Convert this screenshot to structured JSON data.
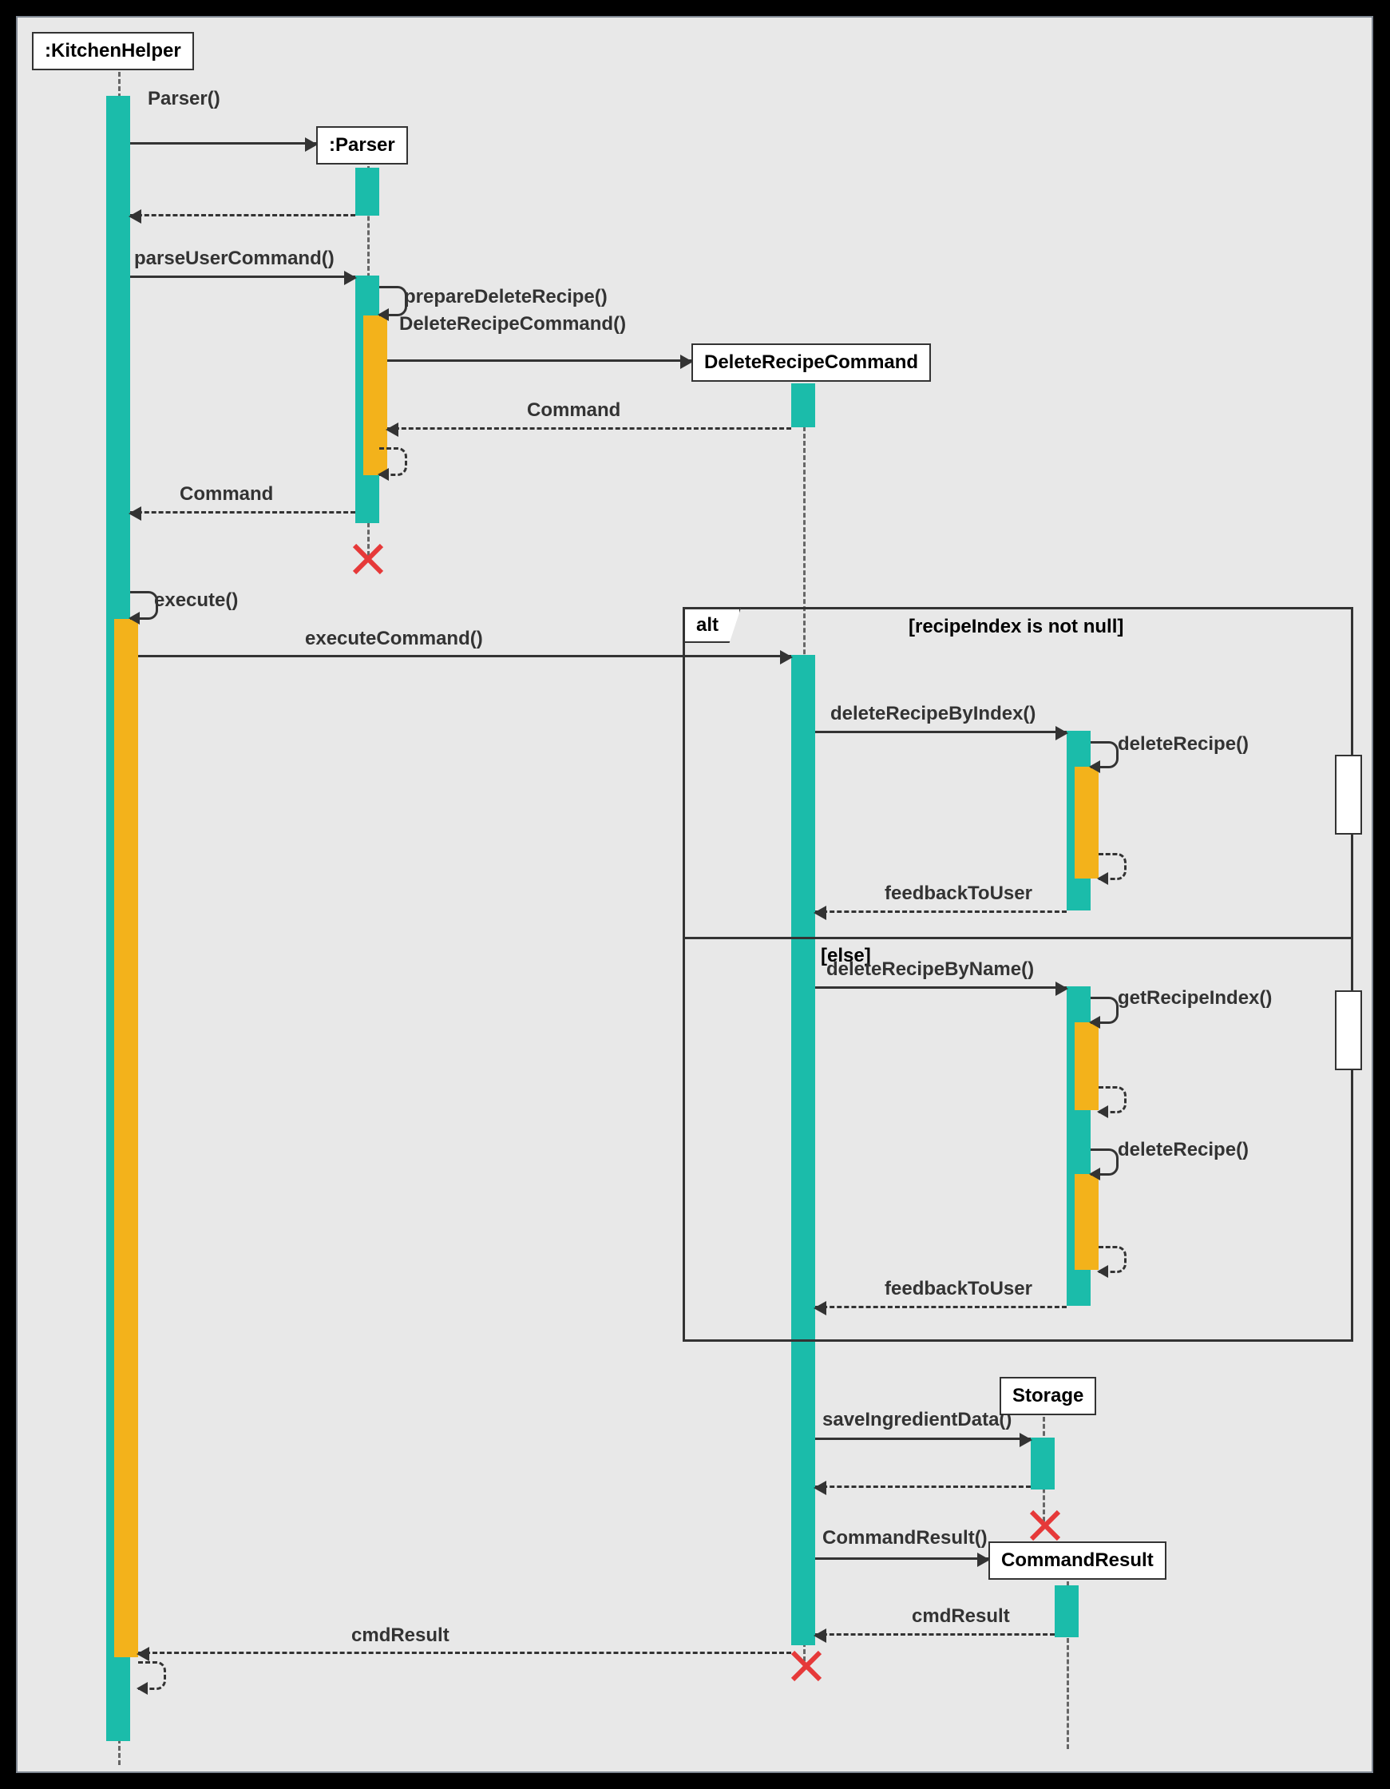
{
  "lifelines": {
    "kitchen": ":KitchenHelper",
    "parser": ":Parser",
    "drc": "DeleteRecipeCommand",
    "storage": "Storage",
    "cmdres": "CommandResult"
  },
  "messages": {
    "parser_new": "Parser()",
    "parse_user": "parseUserCommand()",
    "prep_delete": "prepareDeleteRecipe()",
    "drc_new": "DeleteRecipeCommand()",
    "command_ret1": "Command",
    "command_ret2": "Command",
    "execute": "execute()",
    "execute_cmd": "executeCommand()",
    "del_by_index": "deleteRecipeByIndex()",
    "del_recipe1": "deleteRecipe()",
    "feedback1": "feedbackToUser",
    "del_by_name": "deleteRecipeByName()",
    "get_idx": "getRecipeIndex()",
    "del_recipe2": "deleteRecipe()",
    "feedback2": "feedbackToUser",
    "save_ing": "saveIngredientData()",
    "cmdres_new": "CommandResult()",
    "cmdres_ret1": "cmdResult",
    "cmdres_ret2": "cmdResult"
  },
  "alt": {
    "tag": "alt",
    "guard1": "[recipeIndex is not null]",
    "guard2": "[else]"
  }
}
